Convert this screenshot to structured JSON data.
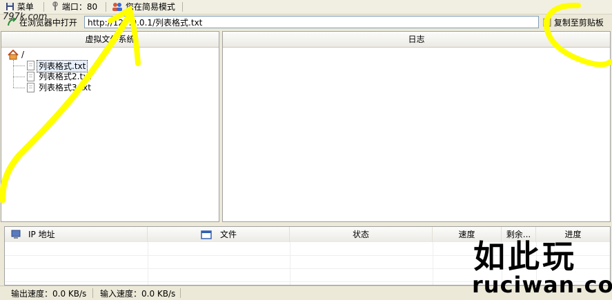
{
  "toolbar": {
    "menu_label": "菜单",
    "port_label": "端口：80",
    "mode_label": "您在简易模式"
  },
  "address_bar": {
    "open_in_browser_label": "在浏览器中打开",
    "url_value": "http://127.0.0.1/列表格式.txt",
    "copy_label": "复制至剪贴板"
  },
  "vfs_panel": {
    "title": "虚拟文件系统",
    "root_label": "/",
    "files": [
      "列表格式.txt",
      "列表格式2.txt",
      "列表格式3.txt"
    ]
  },
  "log_panel": {
    "title": "日志"
  },
  "connections_table": {
    "columns": [
      "IP 地址",
      "文件",
      "状态",
      "速度",
      "剩余...",
      "进度"
    ],
    "rows": []
  },
  "statusbar": {
    "out_speed": "输出速度：0.0 KB/s",
    "in_speed": "输入速度：0.0 KB/s"
  },
  "watermark": {
    "brand": "如此玩",
    "domain": "ruciwan.com",
    "corner": "797k.com"
  },
  "colors": {
    "annotation": "#ffff00",
    "panel_bg": "#ffffff",
    "chrome_bg": "#ece9d8"
  },
  "icons": [
    "floppy-icon",
    "port-icon",
    "users-icon",
    "browser-icon",
    "clipboard-icon",
    "home-folder-icon",
    "file-icon",
    "network-computer-icon",
    "window-icon"
  ]
}
